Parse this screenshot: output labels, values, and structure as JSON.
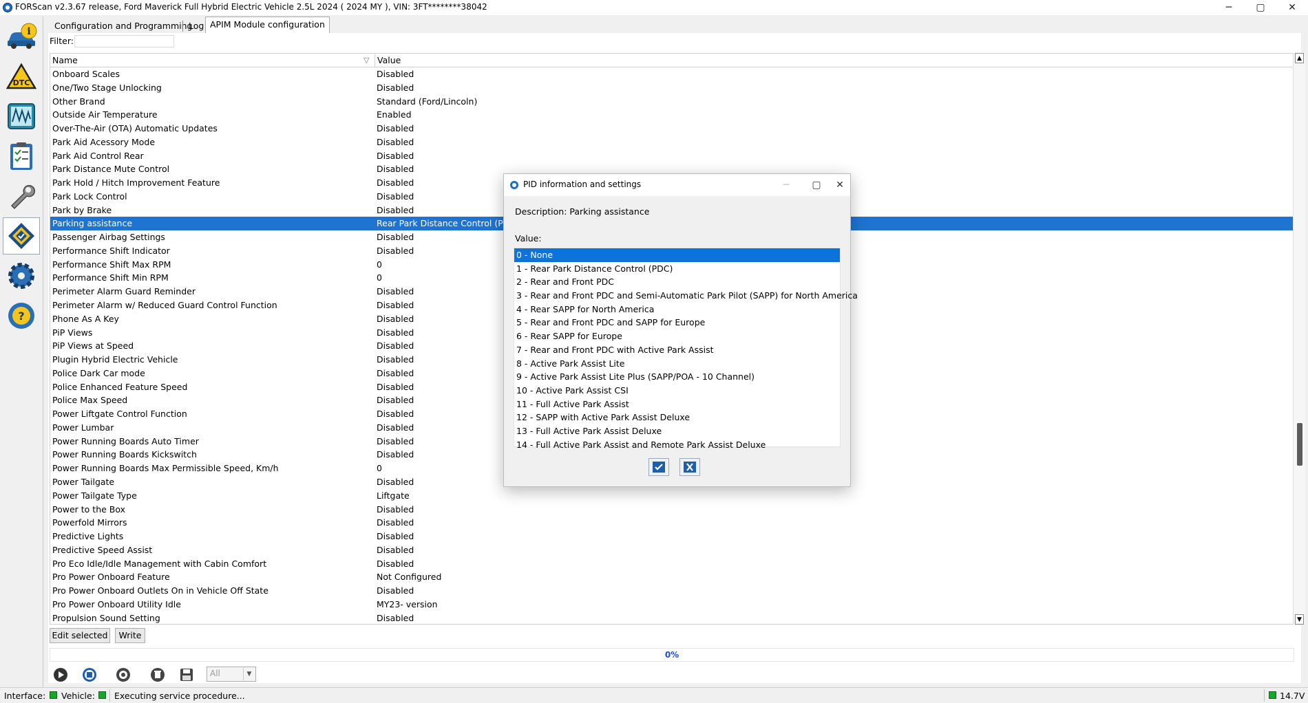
{
  "window": {
    "title": "FORScan v2.3.67 release, Ford Maverick Full Hybrid Electric Vehicle 2.5L 2024 ( 2024 MY ), VIN: 3FT********38042",
    "min_glyph": "─",
    "max_glyph": "▢",
    "close_glyph": "✕"
  },
  "sidebar": {
    "items": [
      {
        "name": "vehicle-info",
        "glyph": "i"
      },
      {
        "name": "dtc",
        "glyph": "DTC"
      },
      {
        "name": "oscilloscope",
        "glyph": "〰"
      },
      {
        "name": "tests",
        "glyph": "✓"
      },
      {
        "name": "service-functions",
        "glyph": "🔧"
      },
      {
        "name": "configuration-programming",
        "glyph": "◈"
      },
      {
        "name": "settings",
        "glyph": "⚙"
      },
      {
        "name": "help",
        "glyph": "?"
      }
    ]
  },
  "tabs": [
    "Configuration and Programming",
    "Log",
    "APIM Module configuration"
  ],
  "filter": {
    "label": "Filter:",
    "value": ""
  },
  "grid": {
    "headers": {
      "name": "Name",
      "value": "Value"
    },
    "rows": [
      {
        "name": "Onboard Scales",
        "value": "Disabled"
      },
      {
        "name": "One/Two Stage Unlocking",
        "value": "Disabled"
      },
      {
        "name": "Other Brand",
        "value": "Standard (Ford/Lincoln)"
      },
      {
        "name": "Outside Air Temperature",
        "value": "Enabled"
      },
      {
        "name": "Over-The-Air (OTA) Automatic Updates",
        "value": "Disabled"
      },
      {
        "name": "Park Aid Acessory Mode",
        "value": "Disabled"
      },
      {
        "name": "Park Aid Control Rear",
        "value": "Disabled"
      },
      {
        "name": "Park Distance Mute Control",
        "value": "Disabled"
      },
      {
        "name": "Park Hold / Hitch Improvement Feature",
        "value": "Disabled"
      },
      {
        "name": "Park Lock Control",
        "value": "Disabled"
      },
      {
        "name": "Park by Brake",
        "value": "Disabled"
      },
      {
        "name": "Parking assistance",
        "value": "Rear Park Distance Control (PDC"
      },
      {
        "name": "Passenger Airbag Settings",
        "value": "Disabled"
      },
      {
        "name": "Performance Shift Indicator",
        "value": "Disabled"
      },
      {
        "name": "Performance Shift Max RPM",
        "value": "0"
      },
      {
        "name": "Performance Shift Min RPM",
        "value": "0"
      },
      {
        "name": "Perimeter Alarm Guard Reminder",
        "value": "Disabled"
      },
      {
        "name": "Perimeter Alarm w/ Reduced Guard Control Function",
        "value": "Disabled"
      },
      {
        "name": "Phone As A Key",
        "value": "Disabled"
      },
      {
        "name": "PiP Views",
        "value": "Disabled"
      },
      {
        "name": "PiP Views at Speed",
        "value": "Disabled"
      },
      {
        "name": "Plugin Hybrid Electric Vehicle",
        "value": "Disabled"
      },
      {
        "name": "Police Dark Car mode",
        "value": "Disabled"
      },
      {
        "name": "Police Enhanced Feature Speed",
        "value": "Disabled"
      },
      {
        "name": "Police Max Speed",
        "value": "Disabled"
      },
      {
        "name": "Power Liftgate Control Function",
        "value": "Disabled"
      },
      {
        "name": "Power Lumbar",
        "value": "Disabled"
      },
      {
        "name": "Power Running Boards Auto Timer",
        "value": "Disabled"
      },
      {
        "name": "Power Running Boards Kickswitch",
        "value": "Disabled"
      },
      {
        "name": "Power Running Boards Max Permissible Speed, Km/h",
        "value": "0"
      },
      {
        "name": "Power Tailgate",
        "value": "Disabled"
      },
      {
        "name": "Power Tailgate Type",
        "value": "Liftgate"
      },
      {
        "name": "Power to the Box",
        "value": "Disabled"
      },
      {
        "name": "Powerfold Mirrors",
        "value": "Disabled"
      },
      {
        "name": "Predictive Lights",
        "value": "Disabled"
      },
      {
        "name": "Predictive Speed Assist",
        "value": "Disabled"
      },
      {
        "name": "Pro Eco Idle/Idle Management with Cabin Comfort",
        "value": "Disabled"
      },
      {
        "name": "Pro Power Onboard Feature",
        "value": "Not Configured"
      },
      {
        "name": "Pro Power Onboard Outlets On in Vehicle Off State",
        "value": "Disabled"
      },
      {
        "name": "Pro Power Onboard Utility Idle",
        "value": "MY23- version"
      },
      {
        "name": "Propulsion Sound Setting",
        "value": "Disabled"
      }
    ],
    "selected_index": 11
  },
  "buttons": {
    "edit_selected": "Edit selected",
    "write": "Write"
  },
  "progress": {
    "text": "0%",
    "fraction": 0
  },
  "toolbar": {
    "combo_value": "All"
  },
  "statusbar": {
    "interface_label": "Interface:",
    "vehicle_label": "Vehicle:",
    "message": "Executing service procedure...",
    "voltage": "14.7V",
    "status_color": "#17a52a"
  },
  "dialog": {
    "title": "PID information and settings",
    "description": "Description: Parking assistance",
    "value_label": "Value:",
    "options": [
      "0 - None",
      "1 - Rear Park Distance Control (PDC)",
      "2 - Rear and Front PDC",
      "3 - Rear and Front PDC and Semi-Automatic Park Pilot (SAPP) for North America",
      "4 - Rear SAPP for North America",
      "5 - Rear and Front PDC and SAPP for Europe",
      "6 - Rear SAPP for Europe",
      "7 - Rear and Front PDC with Active Park Assist",
      "8 - Active Park Assist Lite",
      "9 - Active Park Assist Lite Plus (SAPP/POA - 10 Channel)",
      "10 - Active Park Assist CSI",
      "11 - Full Active Park Assist",
      "12 - SAPP with Active Park Assist Deluxe",
      "13 - Full Active Park Assist Deluxe",
      "14 - Full Active Park Assist and Remote Park Assist Deluxe"
    ],
    "selected_index": 0
  },
  "colors": {
    "selection": "#1e74d3",
    "accent": "#1f6fbd"
  }
}
